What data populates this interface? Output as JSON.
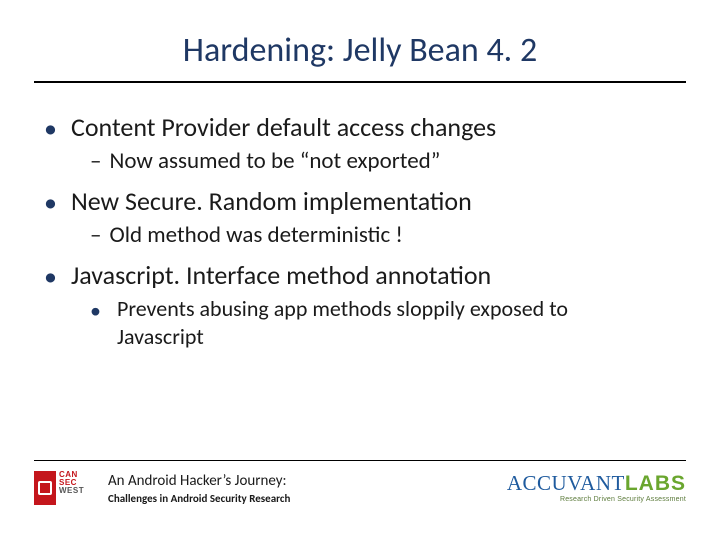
{
  "title": "Hardening: Jelly Bean 4. 2",
  "bullets": {
    "b1a": "Content Provider default access changes",
    "b2a": "Now assumed to be “not exported”",
    "b1b": "New Secure. Random implementation",
    "b2b": "Old method was deterministic !",
    "b1c": "Javascript. Interface method annotation",
    "b3c": "Prevents abusing app methods sloppily exposed to Javascript"
  },
  "footer": {
    "title": "An Android Hacker’s Journey:",
    "subtitle": "Challenges in Android Security Research",
    "cansec_lines": [
      "CAN",
      "SEC",
      "WEST"
    ],
    "accuvant_a": "ACCUVANT",
    "accuvant_b": "LABS",
    "accuvant_tag": "Research Driven Security Assessment"
  }
}
